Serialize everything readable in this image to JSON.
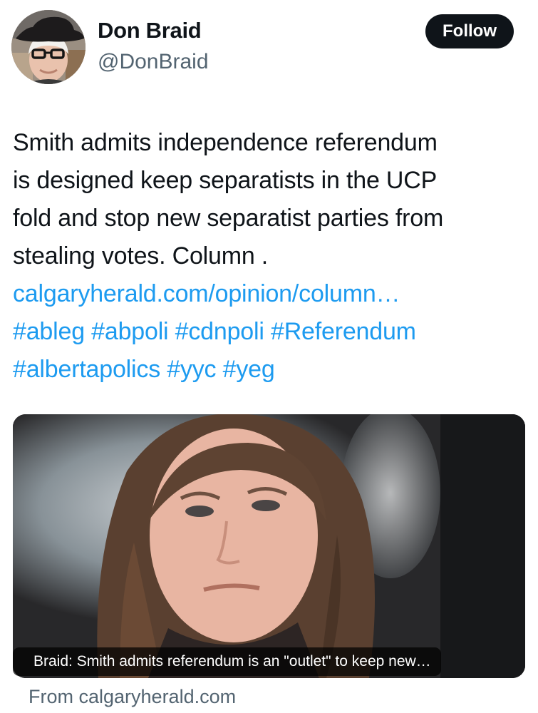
{
  "author": {
    "name": "Don Braid",
    "handle": "@DonBraid"
  },
  "follow_button": {
    "label": "Follow"
  },
  "tweet": {
    "text_lines": [
      "Smith admits independence referendum",
      "is designed keep separatists in the UCP",
      "fold and stop new separatist parties from",
      "stealing votes. Column ."
    ],
    "link": "calgaryherald.com/opinion/column…",
    "hashtags": [
      "#ableg",
      "#abpoli",
      "#cdnpoli",
      "#Referendum",
      "#albertapolics",
      "#yyc",
      "#yeg"
    ]
  },
  "link_card": {
    "caption": "Braid: Smith admits referendum is an \"outlet\" to keep new…",
    "source": "From calgaryherald.com"
  },
  "colors": {
    "text": "#0f1419",
    "secondary": "#536471",
    "link": "#1d9bf0",
    "button_bg": "#0f1419",
    "button_text": "#ffffff"
  }
}
